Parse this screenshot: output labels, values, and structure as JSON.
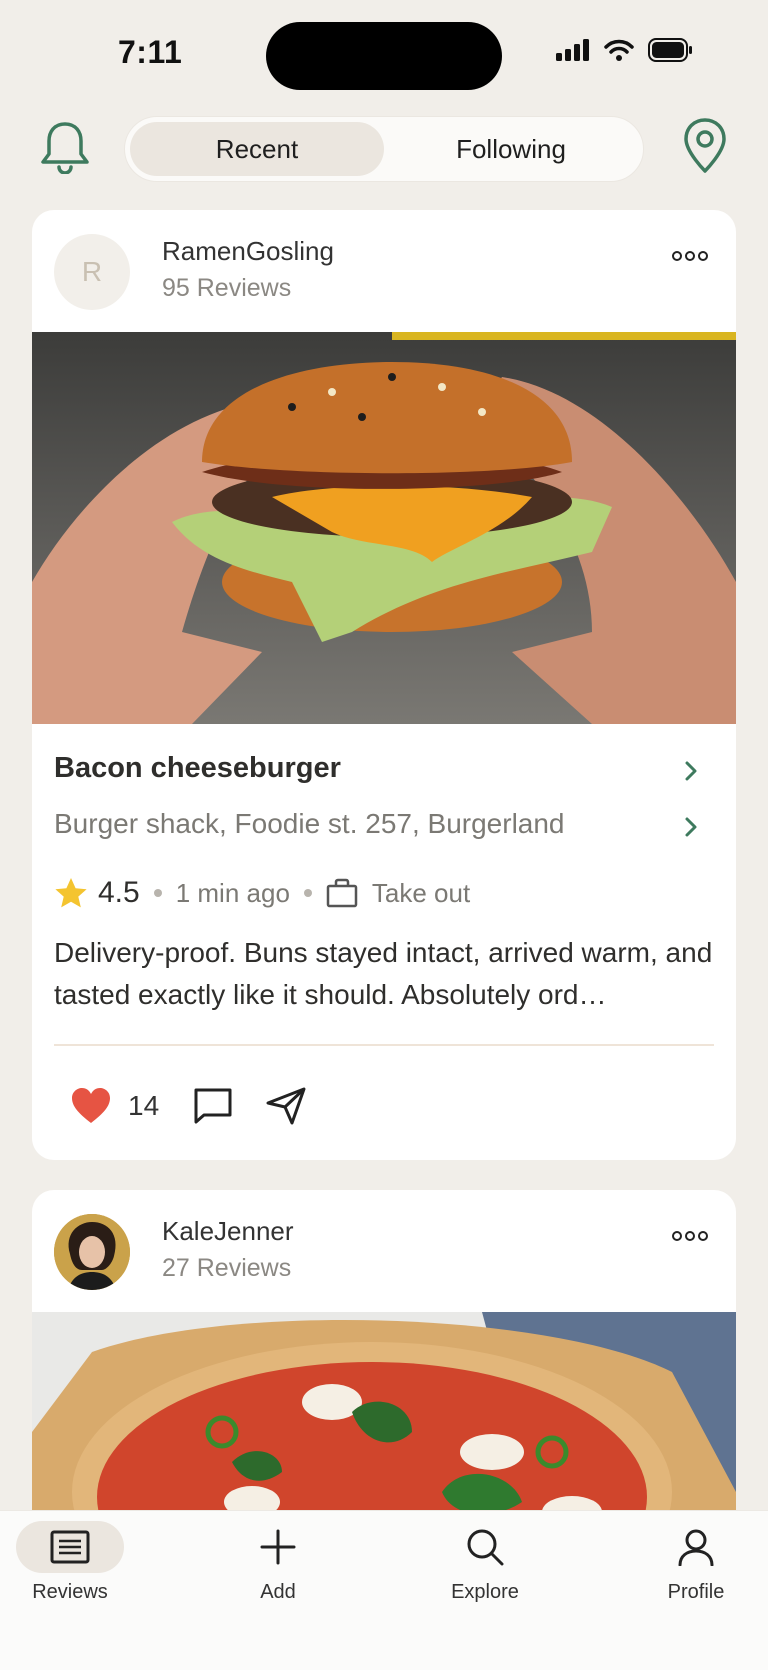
{
  "status": {
    "time": "7:11"
  },
  "header": {
    "tabs": [
      {
        "label": "Recent",
        "active": true
      },
      {
        "label": "Following",
        "active": false
      }
    ]
  },
  "posts": [
    {
      "user_initial": "R",
      "user_name": "RamenGosling",
      "reviews": "95 Reviews",
      "dish": "Bacon cheeseburger",
      "place": "Burger shack, Foodie st. 257, Burgerland",
      "rating": "4.5",
      "time_ago": "1 min ago",
      "service": "Take out",
      "text": "Delivery-proof. Buns stayed intact, arrived warm, and tasted exactly like it should. Absolutely ord…",
      "likes": "14"
    },
    {
      "user_name": "KaleJenner",
      "reviews": "27 Reviews"
    }
  ],
  "nav": {
    "items": [
      {
        "label": "Reviews",
        "icon": "reviews-icon",
        "active": true
      },
      {
        "label": "Add",
        "icon": "plus-icon"
      },
      {
        "label": "Explore",
        "icon": "search-icon"
      },
      {
        "label": "Profile",
        "icon": "user-icon"
      }
    ]
  },
  "colors": {
    "accent": "#3e7a5e",
    "background": "#f1eee9",
    "star": "#f4c430",
    "heart": "#e65443"
  }
}
